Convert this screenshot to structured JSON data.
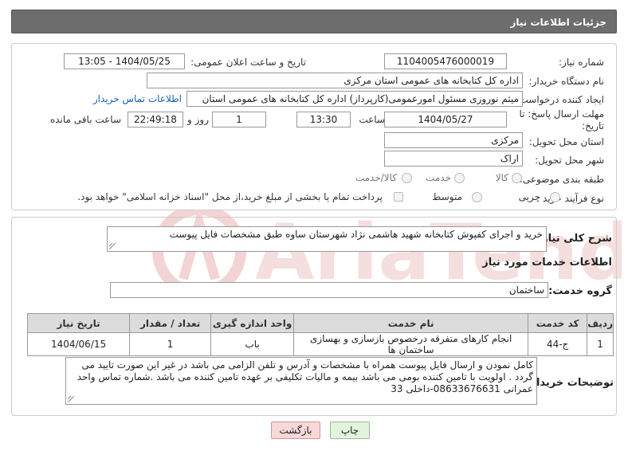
{
  "header": {
    "title": "جزئیات اطلاعات نیاز"
  },
  "need_number": {
    "label": "شماره نیاز:",
    "value": "1104005476000019"
  },
  "announce": {
    "label": "تاریخ و ساعت اعلان عمومی:",
    "value": "1404/05/25 - 13:05"
  },
  "buyer_org": {
    "label": "نام دستگاه خریدار:",
    "value": "اداره کل کتابخانه های عمومی استان مرکزی"
  },
  "creator": {
    "label": "ایجاد کننده درخواست:",
    "value": "میثم نوروزی مسئول امورعمومی(کارپرداز) اداره کل کتابخانه های عمومی استان",
    "link": "اطلاعات تماس خریدار"
  },
  "deadline": {
    "label_line1": "مهلت ارسال پاسخ: تا",
    "label_line2": "تاریخ:",
    "date": "1404/05/27",
    "time_label": "ساعت",
    "time": "13:30",
    "days": "1",
    "days_label": "روز و",
    "remaining": "22:49:18",
    "remaining_label": "ساعت باقی مانده"
  },
  "province": {
    "label": "استان محل تحویل:",
    "value": "مرکزی"
  },
  "city": {
    "label": "شهر محل تحویل:",
    "value": "اراک"
  },
  "category": {
    "label": "طبقه بندی موضوعی:",
    "options": [
      "کالا",
      "خدمت",
      "کالا/خدمت"
    ]
  },
  "process": {
    "label": "نوع فرآیند خرید :",
    "options": [
      "جزیی",
      "متوسط"
    ],
    "payment_note": "پرداخت تمام یا بخشی از مبلغ خرید،از محل \"اسناد خزانه اسلامی\" خواهد بود."
  },
  "summary": {
    "label": "شرح کلی نیاز:",
    "value": "خرید و اجرای کفپوش کتابخانه شهید هاشمی نژاد شهرستان ساوه طبق مشخصات فایل پیوست"
  },
  "services_title": "اطلاعات خدمات مورد نیاز",
  "service_group": {
    "label": "گروه خدمت:",
    "value": "ساختمان"
  },
  "table": {
    "headers": [
      "ردیف",
      "کد خدمت",
      "نام خدمت",
      "واحد اندازه گیری",
      "تعداد / مقدار",
      "تاریخ نیاز"
    ],
    "rows": [
      [
        "1",
        "ج-44",
        "انجام کارهای متفرقه درخصوص بازسازی و بهسازی ساختمان ها",
        "باب",
        "1",
        "1404/06/15"
      ]
    ]
  },
  "buyer_notes": {
    "label": "توضیحات خریدار:",
    "value": "کامل نمودن و ارسال فایل پیوست همراه با مشخصات و آدرس و تلفن الزامی می باشد در غیر این صورت تایید می گردد . اولویت با تامین کننده بومی می باشد بیمه و مالیات تکلیفی بر عهده تامین کننده می باشد .شماره تماس واحد عمرانی 08633676631-داخلی 33"
  },
  "buttons": {
    "print": "چاپ",
    "back": "بازگشت"
  },
  "colors": {
    "header_bg": "#6d6d6d",
    "link": "#1a5fb4",
    "back_bg": "#f9d8d8",
    "print_bg": "#e2f4dc"
  }
}
